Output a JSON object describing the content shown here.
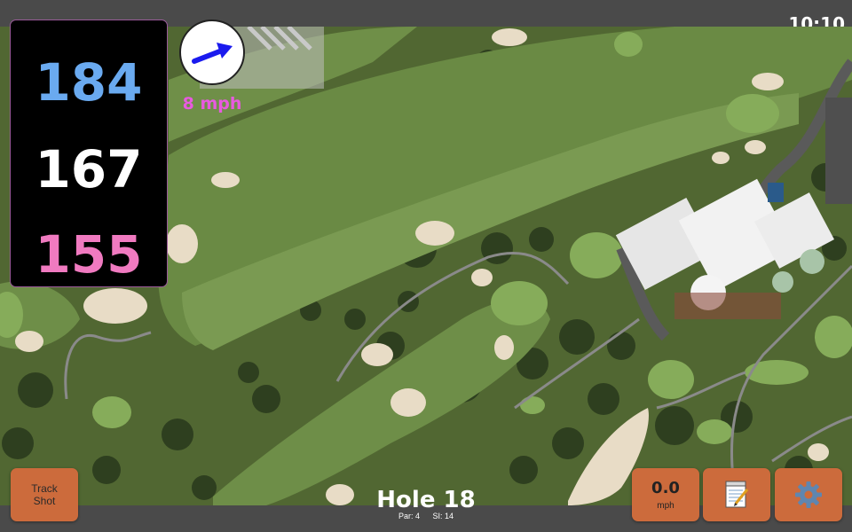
{
  "status_bar": {
    "time": "10:10"
  },
  "distances": {
    "back": "184",
    "middle": "167",
    "front": "155"
  },
  "wind": {
    "speed_label": "8 mph",
    "direction_icon": "arrow-icon"
  },
  "hole": {
    "title": "Hole 18",
    "par": "Par: 4",
    "stroke_index": "SI: 14"
  },
  "buttons": {
    "track_shot_line1": "Track",
    "track_shot_line2": "Shot",
    "speed_value": "0.0",
    "speed_unit": "mph",
    "notes_icon": "notepad-icon",
    "settings_icon": "gear-icon"
  },
  "colors": {
    "back_distance": "#6aaaf0",
    "middle_distance": "#ffffff",
    "front_distance": "#f07ac0",
    "wind_text": "#e85ae0",
    "button_bg": "#cc6b3c"
  }
}
